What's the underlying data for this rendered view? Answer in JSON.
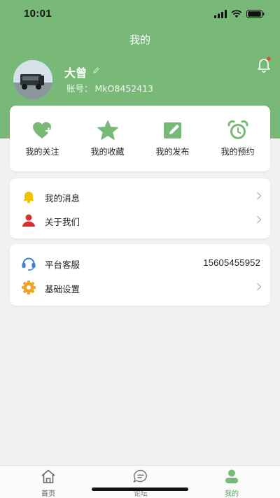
{
  "status_bar": {
    "time": "10:01"
  },
  "header": {
    "title": "我的"
  },
  "profile": {
    "name": "大曾",
    "account_label": "账号：",
    "account_id": "MkO8452413"
  },
  "quick_actions": [
    {
      "label": "我的关注",
      "icon": "heart-plus-icon"
    },
    {
      "label": "我的收藏",
      "icon": "star-icon"
    },
    {
      "label": "我的发布",
      "icon": "edit-square-icon"
    },
    {
      "label": "我的预约",
      "icon": "alarm-clock-icon"
    }
  ],
  "menu_group_1": [
    {
      "label": "我的消息",
      "icon": "bell-icon"
    },
    {
      "label": "关于我们",
      "icon": "person-icon"
    }
  ],
  "menu_group_2": [
    {
      "label": "平台客服",
      "icon": "headset-icon",
      "value": "15605455952"
    },
    {
      "label": "基础设置",
      "icon": "gear-icon"
    }
  ],
  "tabs": [
    {
      "label": "首页",
      "icon": "home-icon"
    },
    {
      "label": "论坛",
      "icon": "chat-icon"
    },
    {
      "label": "我的",
      "icon": "user-icon",
      "active": true
    }
  ],
  "colors": {
    "primary": "#79b978",
    "notification_dot": "#e2483b",
    "message_icon": "#f2c300",
    "about_icon": "#d9302c",
    "service_icon": "#3c7fd0",
    "settings_icon": "#f0a224"
  }
}
